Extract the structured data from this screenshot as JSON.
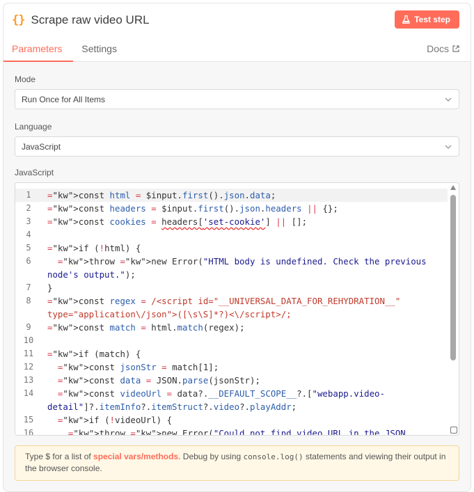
{
  "header": {
    "icon": "{}",
    "title": "Scrape raw video URL",
    "test_label": "Test step"
  },
  "tabs": [
    {
      "label": "Parameters"
    },
    {
      "label": "Settings"
    }
  ],
  "docs_label": "Docs",
  "mode": {
    "label": "Mode",
    "value": "Run Once for All Items"
  },
  "language": {
    "label": "Language",
    "value": "JavaScript"
  },
  "code_label": "JavaScript",
  "notice": {
    "part1": "Type $ for a list of ",
    "link": "special vars/methods",
    "part2": ". Debug by using ",
    "mono": "console.log()",
    "part3": " statements and viewing their output in the browser console."
  },
  "code_lines": [
    {
      "n": "1",
      "text": "const html = $input.first().json.data;"
    },
    {
      "n": "2",
      "text": "const headers = $input.first().json.headers || {};"
    },
    {
      "n": "3",
      "text": "const cookies = headers['set-cookie'] || [];"
    },
    {
      "n": "4",
      "text": ""
    },
    {
      "n": "5",
      "text": "if (!html) {"
    },
    {
      "n": "6",
      "text": "  throw new Error(\"HTML body is undefined. Check the previous node's output.\");"
    },
    {
      "n": "7",
      "text": "}"
    },
    {
      "n": "8",
      "text": "const regex = /<script id=\"__UNIVERSAL_DATA_FOR_REHYDRATION__\" type=\"application\\/json\">([\\s\\S]*?)<\\/script>/;"
    },
    {
      "n": "9",
      "text": "const match = html.match(regex);"
    },
    {
      "n": "10",
      "text": ""
    },
    {
      "n": "11",
      "text": "if (match) {"
    },
    {
      "n": "12",
      "text": "  const jsonStr = match[1];"
    },
    {
      "n": "13",
      "text": "  const data = JSON.parse(jsonStr);"
    },
    {
      "n": "14",
      "text": "  const videoUrl = data?.__DEFAULT_SCOPE__?.[\"webapp.video-detail\"]?.itemInfo?.itemStruct?.video?.playAddr;"
    },
    {
      "n": "15",
      "text": "  if (!videoUrl) {"
    },
    {
      "n": "16",
      "text": "    throw new Error(\"Could not find video URL in the JSON data.\");"
    }
  ],
  "colors": {
    "accent": "#ff6d5a",
    "icon": "#ff9b26"
  }
}
